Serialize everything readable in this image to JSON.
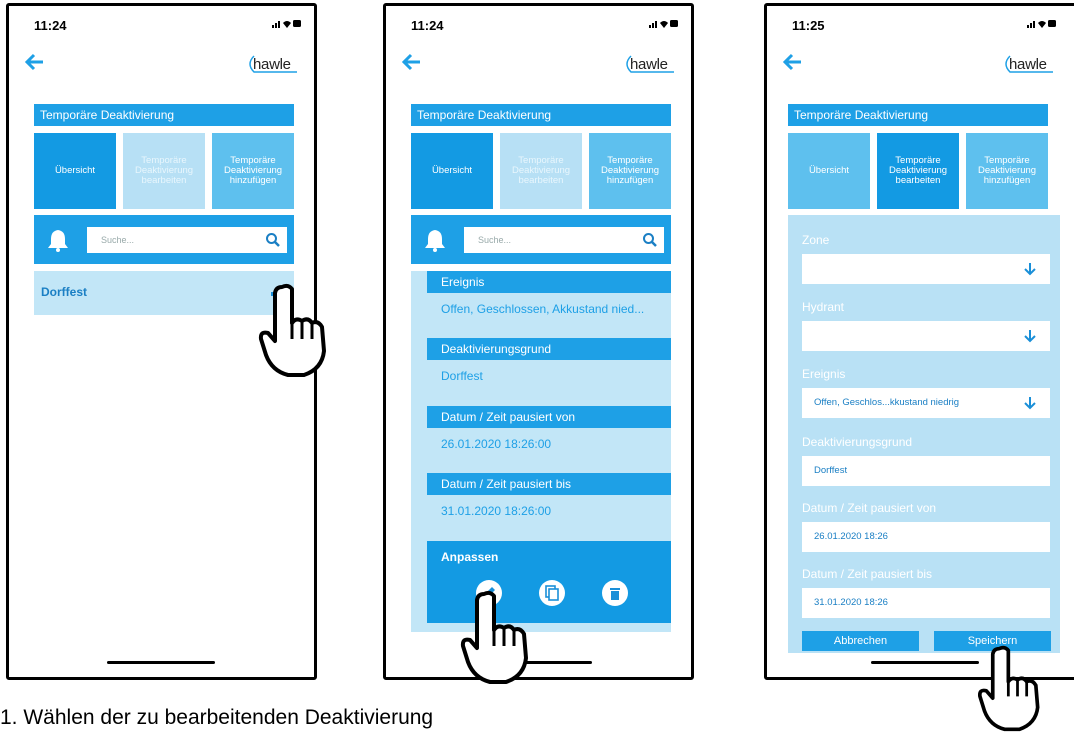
{
  "screens": [
    {
      "time": "11:24",
      "logo": "hawle",
      "header": "Temporäre Deaktivierung",
      "tabs": [
        "Übersicht",
        "Temporäre\nDeaktivierung\nbearbeiten",
        "Temporäre\nDeaktivierung\nhinzufügen"
      ],
      "search_placeholder": "Suche...",
      "list_item": "Dorffest"
    },
    {
      "time": "11:24",
      "logo": "hawle",
      "header": "Temporäre Deaktivierung",
      "tabs": [
        "Übersicht",
        "Temporäre\nDeaktivierung\nbearbeiten",
        "Temporäre\nDeaktivierung\nhinzufügen"
      ],
      "search_placeholder": "Suche...",
      "sections": [
        {
          "label": "Ereignis",
          "value": "Offen, Geschlossen, Akkustand nied..."
        },
        {
          "label": "Deaktivierungsgrund",
          "value": "Dorffest"
        },
        {
          "label": "Datum / Zeit pausiert von",
          "value": "26.01.2020 18:26:00"
        },
        {
          "label": "Datum / Zeit pausiert bis",
          "value": "31.01.2020 18:26:00"
        }
      ],
      "adjust_label": "Anpassen"
    },
    {
      "time": "11:25",
      "logo": "hawle",
      "header": "Temporäre Deaktivierung",
      "tabs": [
        "Übersicht",
        "Temporäre\nDeaktivierung\nbearbeiten",
        "Temporäre\nDeaktivierung\nhinzufügen"
      ],
      "fields": [
        {
          "label": "Zone",
          "value": ""
        },
        {
          "label": "Hydrant",
          "value": ""
        },
        {
          "label": "Ereignis",
          "value": "Offen, Geschlos...kkustand niedrig"
        },
        {
          "label": "Deaktivierungsgrund",
          "value": "Dorffest"
        },
        {
          "label": "Datum / Zeit pausiert von",
          "value": "26.01.2020 18:26"
        },
        {
          "label": "Datum / Zeit pausiert bis",
          "value": "31.01.2020 18:26"
        }
      ],
      "cancel_label": "Abbrechen",
      "save_label": "Speichern"
    }
  ],
  "caption": "1.   Wählen der zu bearbeitenden Deaktivierung",
  "colors": {
    "primary": "#1ea0e6",
    "light": "#c2e6f7",
    "tab_light": "#b7e0f5"
  }
}
